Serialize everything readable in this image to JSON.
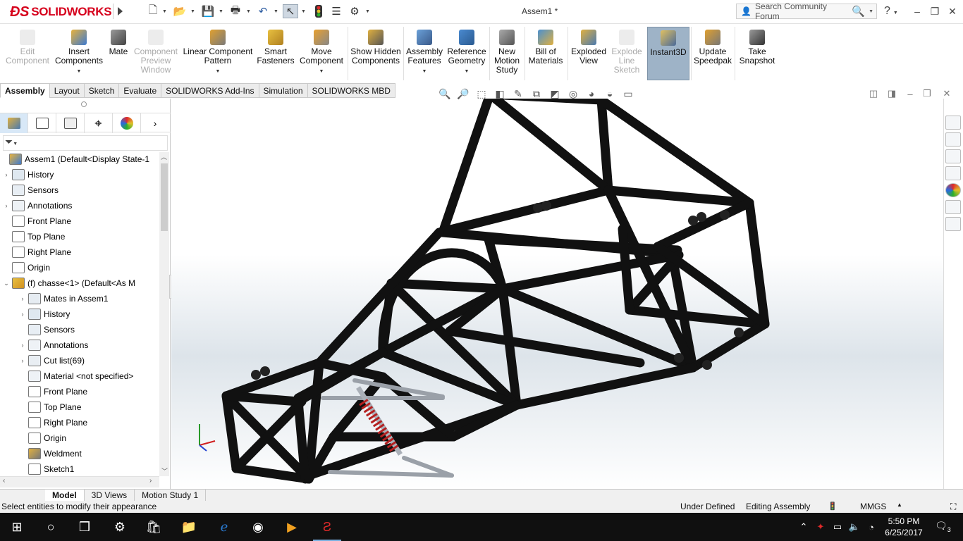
{
  "app": {
    "brand": "SOLIDWORKS",
    "document_title": "Assem1 *",
    "search_placeholder": "Search Community Forum",
    "help_label": "?",
    "accent_red": "#d6001c"
  },
  "quick_access": {
    "icons": [
      "new-document-icon",
      "open-icon",
      "save-icon",
      "print-icon",
      "undo-icon",
      "select-pointer-icon",
      "rebuild-icon",
      "file-properties-icon",
      "options-gear-icon"
    ]
  },
  "ribbon": {
    "buttons": [
      {
        "id": "edit-component",
        "label": "Edit Component",
        "enabled": false
      },
      {
        "id": "insert-components",
        "label": "Insert Components",
        "enabled": true,
        "dropdown": true
      },
      {
        "id": "mate",
        "label": "Mate",
        "enabled": true
      },
      {
        "id": "component-preview-window",
        "label": "Component Preview Window",
        "enabled": false
      },
      {
        "id": "linear-component-pattern",
        "label": "Linear Component Pattern",
        "enabled": true,
        "dropdown": true
      },
      {
        "id": "smart-fasteners",
        "label": "Smart Fasteners",
        "enabled": true
      },
      {
        "id": "move-component",
        "label": "Move Component",
        "enabled": true,
        "dropdown": true
      },
      {
        "id": "show-hidden-components",
        "label": "Show Hidden Components",
        "enabled": true
      },
      {
        "id": "assembly-features",
        "label": "Assembly Features",
        "enabled": true,
        "dropdown": true
      },
      {
        "id": "reference-geometry",
        "label": "Reference Geometry",
        "enabled": true,
        "dropdown": true
      },
      {
        "id": "new-motion-study",
        "label": "New Motion Study",
        "enabled": true
      },
      {
        "id": "bill-of-materials",
        "label": "Bill of Materials",
        "enabled": true
      },
      {
        "id": "exploded-view",
        "label": "Exploded View",
        "enabled": true
      },
      {
        "id": "explode-line-sketch",
        "label": "Explode Line Sketch",
        "enabled": false
      },
      {
        "id": "instant3d",
        "label": "Instant3D",
        "enabled": true,
        "active": true
      },
      {
        "id": "update-speedpak",
        "label": "Update Speedpak",
        "enabled": true
      },
      {
        "id": "take-snapshot",
        "label": "Take Snapshot",
        "enabled": true
      }
    ]
  },
  "command_tabs": [
    "Assembly",
    "Layout",
    "Sketch",
    "Evaluate",
    "SOLIDWORKS Add-Ins",
    "Simulation",
    "SOLIDWORKS MBD"
  ],
  "active_command_tab": "Assembly",
  "feature_tree": {
    "rows": [
      {
        "label": "Assem1  (Default<Display State-1",
        "expander": "",
        "indent": 0,
        "icon": "assembly-icon"
      },
      {
        "label": "History",
        "expander": "›",
        "indent": 1,
        "icon": "history-icon"
      },
      {
        "label": "Sensors",
        "expander": "",
        "indent": 1,
        "icon": "sensors-icon"
      },
      {
        "label": "Annotations",
        "expander": "›",
        "indent": 1,
        "icon": "annotations-icon"
      },
      {
        "label": "Front Plane",
        "expander": "",
        "indent": 1,
        "icon": "plane-icon"
      },
      {
        "label": "Top Plane",
        "expander": "",
        "indent": 1,
        "icon": "plane-icon"
      },
      {
        "label": "Right Plane",
        "expander": "",
        "indent": 1,
        "icon": "plane-icon"
      },
      {
        "label": "Origin",
        "expander": "",
        "indent": 1,
        "icon": "origin-icon"
      },
      {
        "label": "(f) chasse<1> (Default<As M",
        "expander": "⌄",
        "indent": 1,
        "icon": "part-icon"
      },
      {
        "label": "Mates in Assem1",
        "expander": "›",
        "indent": 2,
        "icon": "mates-icon"
      },
      {
        "label": "History",
        "expander": "›",
        "indent": 2,
        "icon": "history-icon"
      },
      {
        "label": "Sensors",
        "expander": "",
        "indent": 2,
        "icon": "sensors-icon"
      },
      {
        "label": "Annotations",
        "expander": "›",
        "indent": 2,
        "icon": "annotations-icon"
      },
      {
        "label": "Cut list(69)",
        "expander": "›",
        "indent": 2,
        "icon": "cut-list-icon"
      },
      {
        "label": "Material <not specified>",
        "expander": "",
        "indent": 2,
        "icon": "material-icon"
      },
      {
        "label": "Front Plane",
        "expander": "",
        "indent": 2,
        "icon": "plane-icon"
      },
      {
        "label": "Top Plane",
        "expander": "",
        "indent": 2,
        "icon": "plane-icon"
      },
      {
        "label": "Right Plane",
        "expander": "",
        "indent": 2,
        "icon": "plane-icon"
      },
      {
        "label": "Origin",
        "expander": "",
        "indent": 2,
        "icon": "origin-icon"
      },
      {
        "label": "Weldment",
        "expander": "",
        "indent": 2,
        "icon": "weldment-icon"
      },
      {
        "label": "Sketch1",
        "expander": "",
        "indent": 2,
        "icon": "sketch-icon"
      }
    ]
  },
  "bottom_tabs": [
    "Model",
    "3D Views",
    "Motion Study 1"
  ],
  "active_bottom_tab": "Model",
  "status": {
    "message": "Select entities to modify their appearance",
    "state": "Under Defined",
    "mode": "Editing Assembly",
    "units": "MMGS"
  },
  "taskbar": {
    "time": "5:50 PM",
    "date": "6/25/2017",
    "notification_count": "3"
  }
}
